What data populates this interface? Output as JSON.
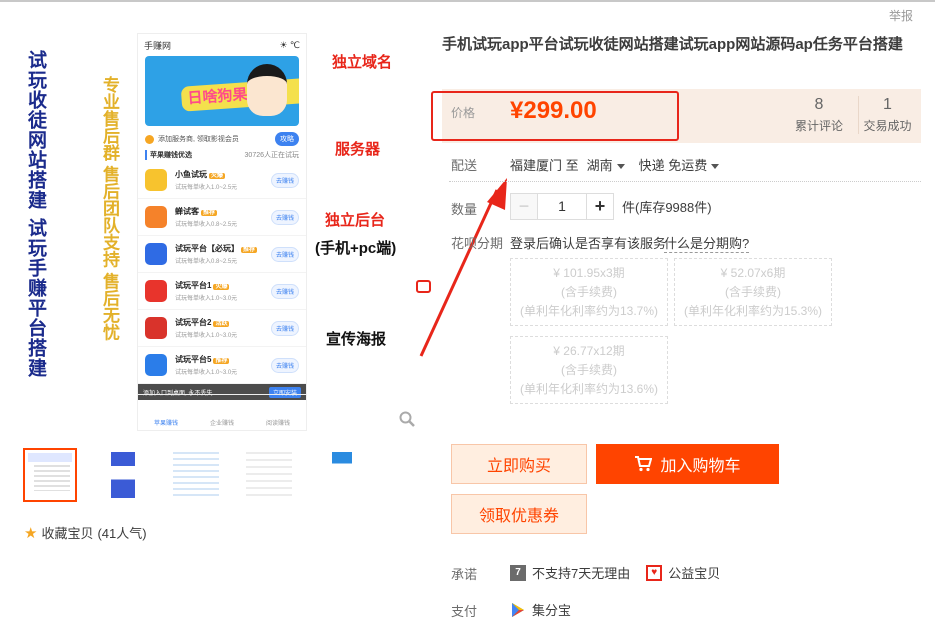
{
  "header": {
    "report": "举报"
  },
  "product": {
    "title": "手机试玩app平台试玩收徒网站搭建试玩app网站源码ap任务平台搭建",
    "price_label": "价格",
    "price": "¥299.00",
    "reviews_count": "8",
    "reviews_label": "累计评论",
    "trades_count": "1",
    "trades_label": "交易成功"
  },
  "shipping": {
    "label": "配送",
    "from": "福建厦门 至",
    "to": "湖南",
    "method": "快递 免运费"
  },
  "quantity": {
    "label": "数量",
    "value": "1",
    "minus": "−",
    "plus": "+",
    "stock": "件(库存9988件)"
  },
  "installments": {
    "label": "花呗分期",
    "note": "登录后确认是否享有该服务",
    "help": "什么是分期购?",
    "options": [
      {
        "amount": "¥ 101.95x3期",
        "fee": "(含手续费)",
        "rate": "(单利年化利率约为13.7%)"
      },
      {
        "amount": "¥ 52.07x6期",
        "fee": "(含手续费)",
        "rate": "(单利年化利率约为15.3%)"
      },
      {
        "amount": "¥ 26.77x12期",
        "fee": "(含手续费)",
        "rate": "(单利年化利率约为13.6%)"
      }
    ]
  },
  "actions": {
    "buy_now": "立即购买",
    "add_to_cart": "加入购物车",
    "coupon": "领取优惠券"
  },
  "promise": {
    "label": "承诺",
    "item1": "不支持7天无理由",
    "item2": "公益宝贝"
  },
  "payment": {
    "label": "支付",
    "item1": "集分宝"
  },
  "favorite": {
    "label": "收藏宝贝",
    "count": "(41人气)"
  },
  "image": {
    "vertical1": "试玩收徒网站搭建",
    "vertical2": "试玩手赚平台搭建",
    "vertical3": "专业售后群 售后团队支持 售后无忧",
    "note_domain": "独立域名",
    "note_server": "服务器",
    "note_admin": "独立后台",
    "note_admin_sub": "(手机+pc端)",
    "note_poster": "宣传海报",
    "phone": {
      "app_name": "手赚网",
      "weather": "℃",
      "banner_title": "日啥狗果",
      "notice": "添加服务商, 领取影视会员",
      "notice_btn": "攻略",
      "section": "苹果赚钱优选",
      "section_count": "30726人正在试玩",
      "apps": [
        {
          "name": "小鱼试玩",
          "tag": "火爆",
          "desc": "试玩每单收入1.0~2.5元",
          "btn": "去赚钱",
          "color": "#f7c32e"
        },
        {
          "name": "蝉试客",
          "tag": "推荐",
          "desc": "试玩每单收入0.8~2.5元",
          "btn": "去赚钱",
          "color": "#f5822a"
        },
        {
          "name": "试玩平台【必玩】",
          "tag": "推荐",
          "desc": "试玩每单收入0.8~2.5元",
          "btn": "去赚钱",
          "color": "#2f6be4"
        },
        {
          "name": "试玩平台1",
          "tag": "火爆",
          "desc": "试玩每单收入1.0~3.0元",
          "btn": "去赚钱",
          "color": "#e8342c"
        },
        {
          "name": "试玩平台2",
          "tag": "活跃",
          "desc": "试玩每单收入1.0~3.0元",
          "btn": "去赚钱",
          "color": "#d9332b"
        },
        {
          "name": "试玩平台5",
          "tag": "推荐",
          "desc": "试玩每单收入1.0~3.0元",
          "btn": "去赚钱",
          "color": "#2b7de9"
        }
      ],
      "toast": "添加入口到桌面, 永不丢失",
      "toast_btn": "立即安装",
      "tabs": [
        "苹果赚钱",
        "企业赚钱",
        "阅读赚钱"
      ]
    }
  }
}
